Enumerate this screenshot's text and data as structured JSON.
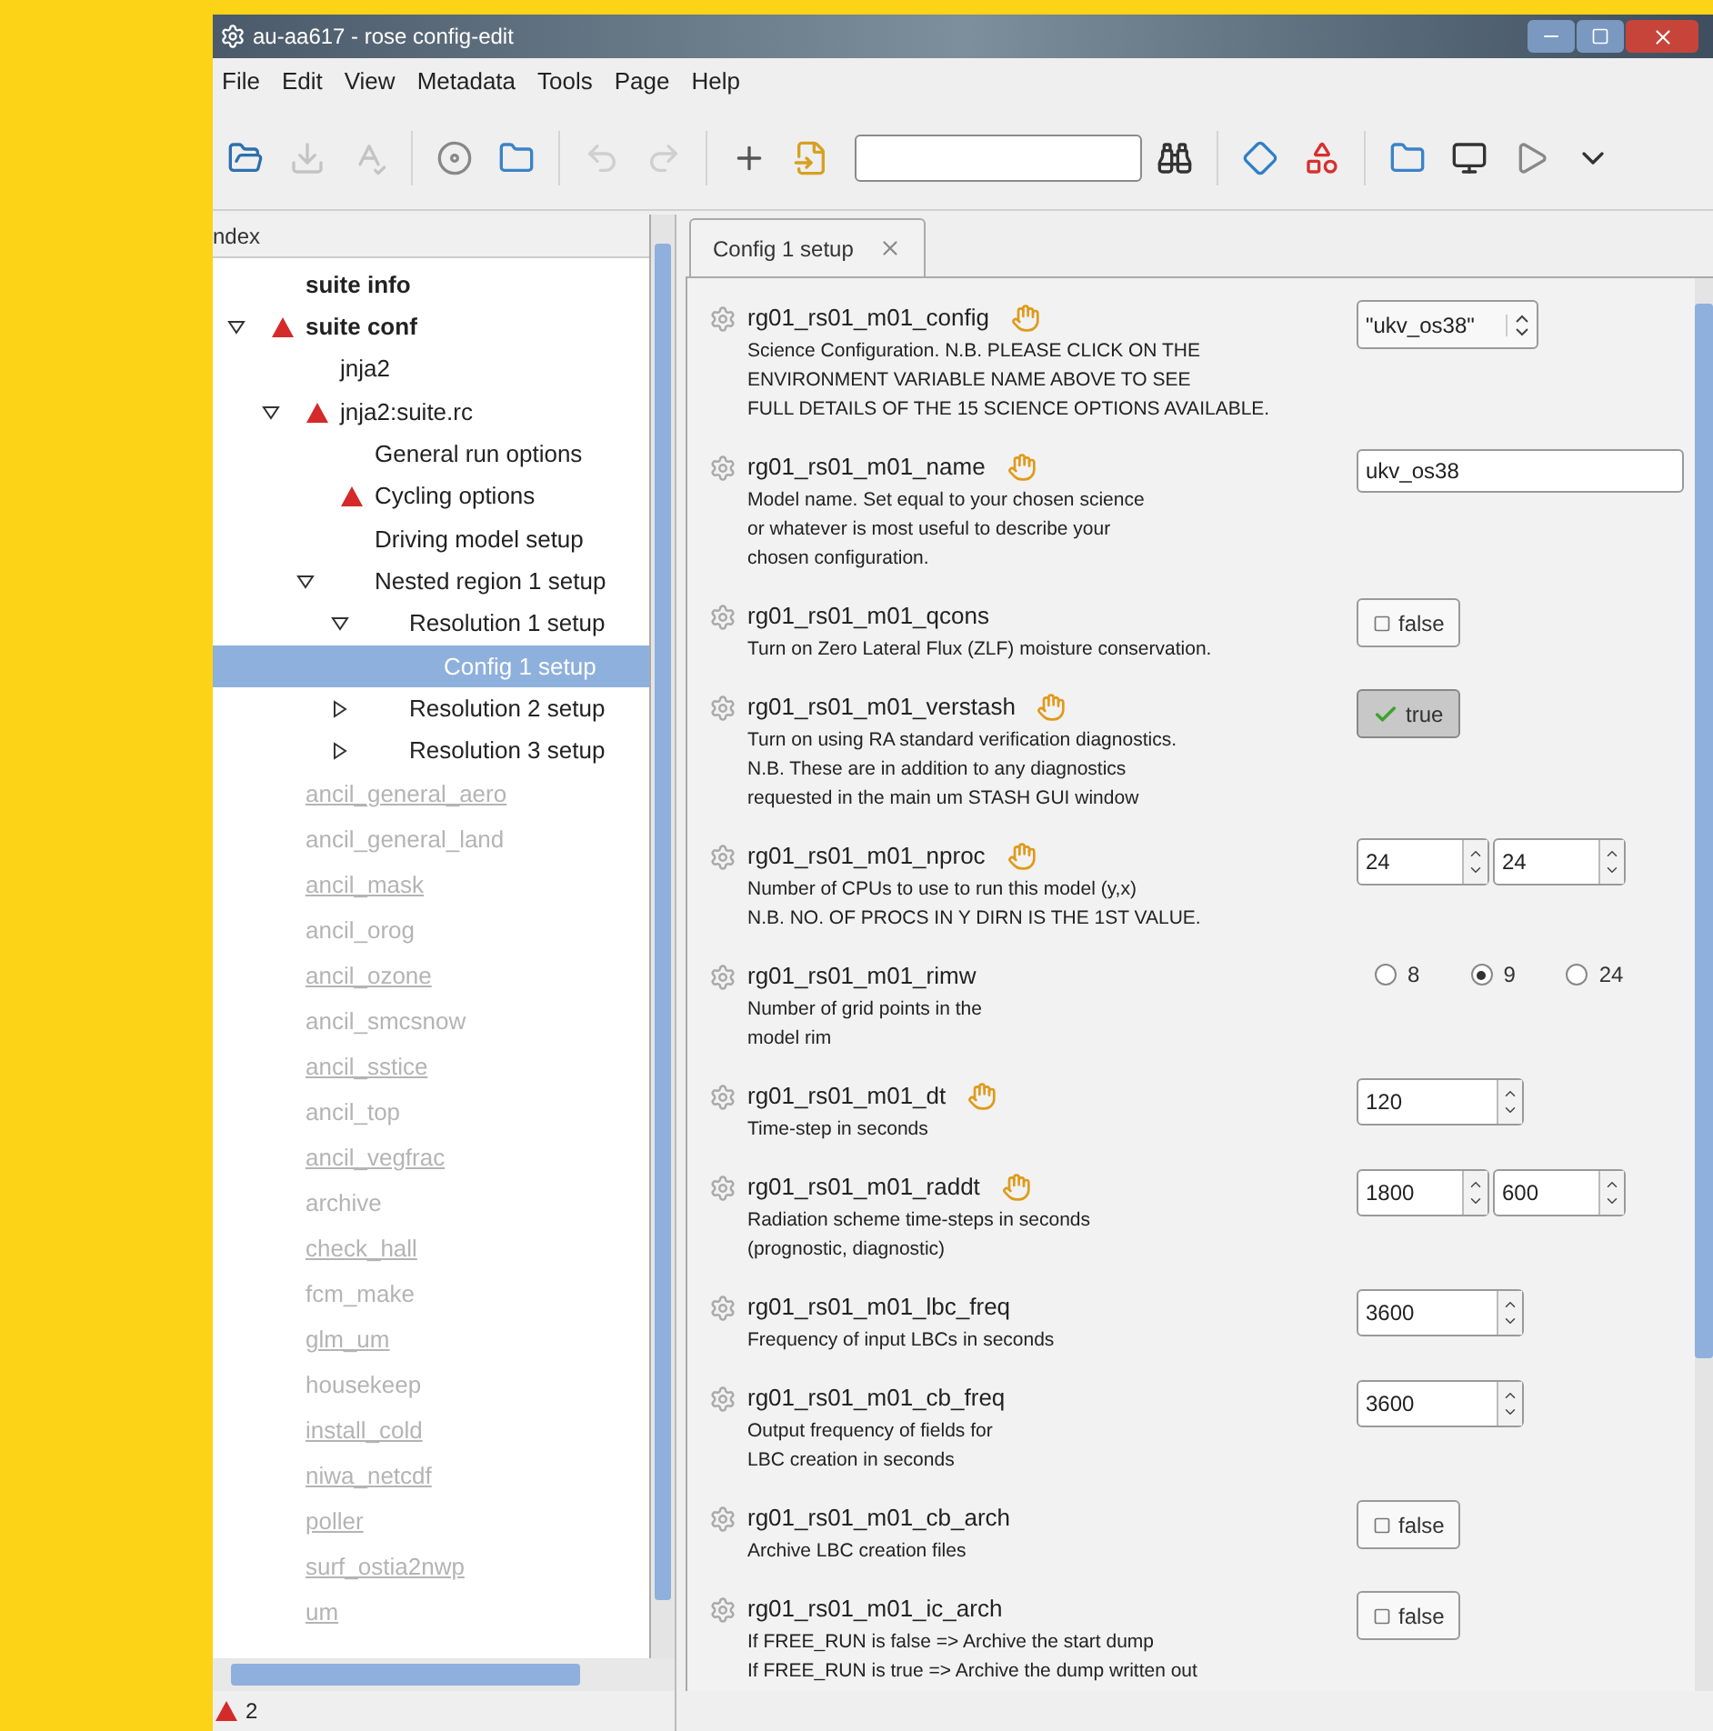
{
  "window": {
    "title": "au-aa617 - rose config-edit"
  },
  "menu": [
    "File",
    "Edit",
    "View",
    "Metadata",
    "Tools",
    "Page",
    "Help"
  ],
  "index": {
    "title": "ndex",
    "items": [
      {
        "label": "suite info",
        "bold": true,
        "warning": false,
        "disabled": false,
        "modified": false,
        "selected": false
      },
      {
        "label": "suite conf",
        "bold": true,
        "warning": true,
        "disabled": false,
        "modified": false,
        "selected": false,
        "expanded": true,
        "children": [
          {
            "label": "jnja2",
            "bold": false,
            "warning": false,
            "disabled": false,
            "modified": false,
            "selected": false
          },
          {
            "label": "jnja2:suite.rc",
            "bold": false,
            "warning": true,
            "disabled": false,
            "modified": false,
            "selected": false,
            "expanded": true,
            "children": [
              {
                "label": "General run options",
                "bold": false,
                "warning": false,
                "disabled": false,
                "modified": false,
                "selected": false
              },
              {
                "label": "Cycling options",
                "bold": false,
                "warning": true,
                "disabled": false,
                "modified": false,
                "selected": false
              },
              {
                "label": "Driving model setup",
                "bold": false,
                "warning": false,
                "disabled": false,
                "modified": false,
                "selected": false
              },
              {
                "label": "Nested region 1 setup",
                "bold": false,
                "warning": false,
                "disabled": false,
                "modified": false,
                "selected": false,
                "expanded": true,
                "children": [
                  {
                    "label": "Resolution 1 setup",
                    "bold": false,
                    "warning": false,
                    "disabled": false,
                    "modified": false,
                    "selected": false,
                    "expanded": true,
                    "children": [
                      {
                        "label": "Config 1 setup",
                        "bold": false,
                        "warning": false,
                        "disabled": false,
                        "modified": false,
                        "selected": true
                      }
                    ]
                  },
                  {
                    "label": "Resolution 2 setup",
                    "bold": false,
                    "warning": false,
                    "disabled": false,
                    "modified": false,
                    "selected": false,
                    "expanded": false
                  },
                  {
                    "label": "Resolution 3 setup",
                    "bold": false,
                    "warning": false,
                    "disabled": false,
                    "modified": false,
                    "selected": false,
                    "expanded": false
                  }
                ]
              }
            ]
          }
        ]
      },
      {
        "label": "ancil_general_aero",
        "bold": false,
        "warning": false,
        "disabled": true,
        "modified": true,
        "selected": false
      },
      {
        "label": "ancil_general_land",
        "bold": false,
        "warning": false,
        "disabled": true,
        "modified": false,
        "selected": false
      },
      {
        "label": "ancil_mask",
        "bold": false,
        "warning": false,
        "disabled": true,
        "modified": true,
        "selected": false
      },
      {
        "label": "ancil_orog",
        "bold": false,
        "warning": false,
        "disabled": true,
        "modified": false,
        "selected": false
      },
      {
        "label": "ancil_ozone",
        "bold": false,
        "warning": false,
        "disabled": true,
        "modified": true,
        "selected": false
      },
      {
        "label": "ancil_smcsnow",
        "bold": false,
        "warning": false,
        "disabled": true,
        "modified": false,
        "selected": false
      },
      {
        "label": "ancil_sstice",
        "bold": false,
        "warning": false,
        "disabled": true,
        "modified": true,
        "selected": false
      },
      {
        "label": "ancil_top",
        "bold": false,
        "warning": false,
        "disabled": true,
        "modified": false,
        "selected": false
      },
      {
        "label": "ancil_vegfrac",
        "bold": false,
        "warning": false,
        "disabled": true,
        "modified": true,
        "selected": false
      },
      {
        "label": "archive",
        "bold": false,
        "warning": false,
        "disabled": true,
        "modified": false,
        "selected": false
      },
      {
        "label": "check_hall",
        "bold": false,
        "warning": false,
        "disabled": true,
        "modified": true,
        "selected": false
      },
      {
        "label": "fcm_make",
        "bold": false,
        "warning": false,
        "disabled": true,
        "modified": false,
        "selected": false
      },
      {
        "label": "glm_um",
        "bold": false,
        "warning": false,
        "disabled": true,
        "modified": true,
        "selected": false
      },
      {
        "label": "housekeep",
        "bold": false,
        "warning": false,
        "disabled": true,
        "modified": false,
        "selected": false
      },
      {
        "label": "install_cold",
        "bold": false,
        "warning": false,
        "disabled": true,
        "modified": true,
        "selected": false
      },
      {
        "label": "niwa_netcdf",
        "bold": false,
        "warning": false,
        "disabled": true,
        "modified": true,
        "selected": false
      },
      {
        "label": "poller",
        "bold": false,
        "warning": false,
        "disabled": true,
        "modified": true,
        "selected": false
      },
      {
        "label": "surf_ostia2nwp",
        "bold": false,
        "warning": false,
        "disabled": true,
        "modified": true,
        "selected": false
      },
      {
        "label": "um",
        "bold": false,
        "warning": false,
        "disabled": true,
        "modified": true,
        "selected": false
      }
    ]
  },
  "tabs": [
    {
      "label": "Config 1 setup",
      "selected": true
    }
  ],
  "settings": [
    {
      "name": "rg01_rs01_m01_config",
      "trigger": true,
      "description": [
        "Science Configuration. N.B. PLEASE CLICK ON THE",
        "ENVIRONMENT VARIABLE NAME ABOVE TO SEE",
        "FULL DETAILS OF THE 15 SCIENCE OPTIONS AVAILABLE."
      ],
      "control": {
        "kind": "combo",
        "value": "\"ukv_os38\""
      }
    },
    {
      "name": "rg01_rs01_m01_name",
      "trigger": true,
      "description": [
        "Model name. Set equal to your chosen science",
        "or whatever is most useful to describe your",
        "chosen configuration."
      ],
      "control": {
        "kind": "entry",
        "value": "ukv_os38"
      }
    },
    {
      "name": "rg01_rs01_m01_qcons",
      "trigger": false,
      "description": [
        "Turn on Zero Lateral Flux (ZLF) moisture conservation."
      ],
      "control": {
        "kind": "toggle",
        "value": "false",
        "checked": false
      }
    },
    {
      "name": "rg01_rs01_m01_verstash",
      "trigger": true,
      "description": [
        "Turn on using RA standard verification diagnostics.",
        "N.B. These are in addition to any diagnostics",
        "requested in the main um STASH GUI window"
      ],
      "control": {
        "kind": "toggle",
        "value": "true",
        "checked": true
      }
    },
    {
      "name": "rg01_rs01_m01_nproc",
      "trigger": true,
      "description": [
        "Number of CPUs to use to run this model (y,x)",
        "N.B. NO. OF PROCS IN Y DIRN IS THE 1ST VALUE."
      ],
      "control": {
        "kind": "spins",
        "values": [
          "24",
          "24"
        ]
      }
    },
    {
      "name": "rg01_rs01_m01_rimw",
      "trigger": false,
      "description": [
        "Number of grid points in the",
        "model rim"
      ],
      "control": {
        "kind": "radio",
        "options": [
          {
            "label": "8",
            "selected": false
          },
          {
            "label": "9",
            "selected": true
          },
          {
            "label": "24",
            "selected": false
          }
        ]
      }
    },
    {
      "name": "rg01_rs01_m01_dt",
      "trigger": true,
      "description": [
        "Time-step in seconds"
      ],
      "control": {
        "kind": "spins",
        "values": [
          "120"
        ]
      }
    },
    {
      "name": "rg01_rs01_m01_raddt",
      "trigger": true,
      "description": [
        "Radiation scheme time-steps in seconds",
        "(prognostic, diagnostic)"
      ],
      "control": {
        "kind": "spins",
        "values": [
          "1800",
          "600"
        ]
      }
    },
    {
      "name": "rg01_rs01_m01_lbc_freq",
      "trigger": false,
      "description": [
        "Frequency of input LBCs in seconds"
      ],
      "control": {
        "kind": "spins",
        "values": [
          "3600"
        ]
      }
    },
    {
      "name": "rg01_rs01_m01_cb_freq",
      "trigger": false,
      "description": [
        "Output frequency of fields for",
        "LBC creation in seconds"
      ],
      "control": {
        "kind": "spins",
        "values": [
          "3600"
        ]
      }
    },
    {
      "name": "rg01_rs01_m01_cb_arch",
      "trigger": false,
      "description": [
        "Archive LBC creation files"
      ],
      "control": {
        "kind": "toggle",
        "value": "false",
        "checked": false
      }
    },
    {
      "name": "rg01_rs01_m01_ic_arch",
      "trigger": false,
      "description": [
        "If FREE_RUN is false => Archive the start dump",
        "If FREE_RUN is true => Archive the dump written out"
      ],
      "control": {
        "kind": "toggle",
        "value": "false",
        "checked": false
      }
    }
  ],
  "status_bar": {
    "errors": "2"
  }
}
